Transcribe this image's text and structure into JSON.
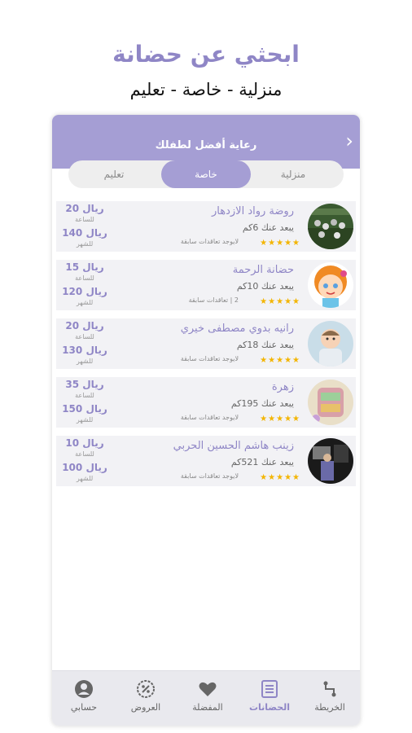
{
  "header": {
    "title": "ابحثي عن حضانة",
    "subtitle": "منزلية - خاصة - تعليم"
  },
  "app": {
    "title": "رعاية أفضل لطفلك",
    "tabs": [
      {
        "label": "منزلية",
        "active": false
      },
      {
        "label": "خاصة",
        "active": true
      },
      {
        "label": "تعليم",
        "active": false
      }
    ]
  },
  "nurseries": [
    {
      "name": "روضة رواد الازدهار",
      "distance": "يبعد عنك 6كم",
      "deals": "لايوجد تعاقدات سابقة",
      "rating": 5,
      "hour_price": "ريال 20",
      "hour_unit": "للساعة",
      "month_price": "ريال 140",
      "month_unit": "للشهر",
      "avatar_icon": "crowd-photo"
    },
    {
      "name": "حضانة الرحمة",
      "distance": "يبعد عنك 10كم",
      "deals": "2 | تعاقدات سابقة",
      "rating": 5,
      "hour_price": "ريال 15",
      "hour_unit": "للساعة",
      "month_price": "ريال 120",
      "month_unit": "للشهر",
      "avatar_icon": "cartoon-girl"
    },
    {
      "name": "رانيه بدوي مصطفى خيري",
      "distance": "يبعد عنك 18كم",
      "deals": "لايوجد تعاقدات سابقة",
      "rating": 5,
      "hour_price": "ريال 20",
      "hour_unit": "للساعة",
      "month_price": "ريال 130",
      "month_unit": "للشهر",
      "avatar_icon": "baby-photo"
    },
    {
      "name": "زهرة",
      "distance": "يبعد عنك 195كم",
      "deals": "لايوجد تعاقدات سابقة",
      "rating": 5,
      "hour_price": "ريال 35",
      "hour_unit": "للساعة",
      "month_price": "ريال 150",
      "month_unit": "للشهر",
      "avatar_icon": "toy-photo"
    },
    {
      "name": "زينب هاشم الحسين الحربي",
      "distance": "يبعد عنك 521كم",
      "deals": "لايوجد تعاقدات سابقة",
      "rating": 5,
      "hour_price": "ريال 10",
      "hour_unit": "للساعة",
      "month_price": "ريال 100",
      "month_unit": "للشهر",
      "avatar_icon": "room-photo"
    }
  ],
  "nav": [
    {
      "label": "الخريطة",
      "icon": "map-route-icon",
      "active": false
    },
    {
      "label": "الحضانات",
      "icon": "list-icon",
      "active": true
    },
    {
      "label": "المفضلة",
      "icon": "heart-icon",
      "active": false
    },
    {
      "label": "العروض",
      "icon": "percent-badge-icon",
      "active": false
    },
    {
      "label": "حسابي",
      "icon": "user-icon",
      "active": false
    }
  ],
  "colors": {
    "accent": "#a59ed4",
    "accent_text": "#8f86c6",
    "star": "#f3b500",
    "card_bg": "#f2f2f5"
  }
}
